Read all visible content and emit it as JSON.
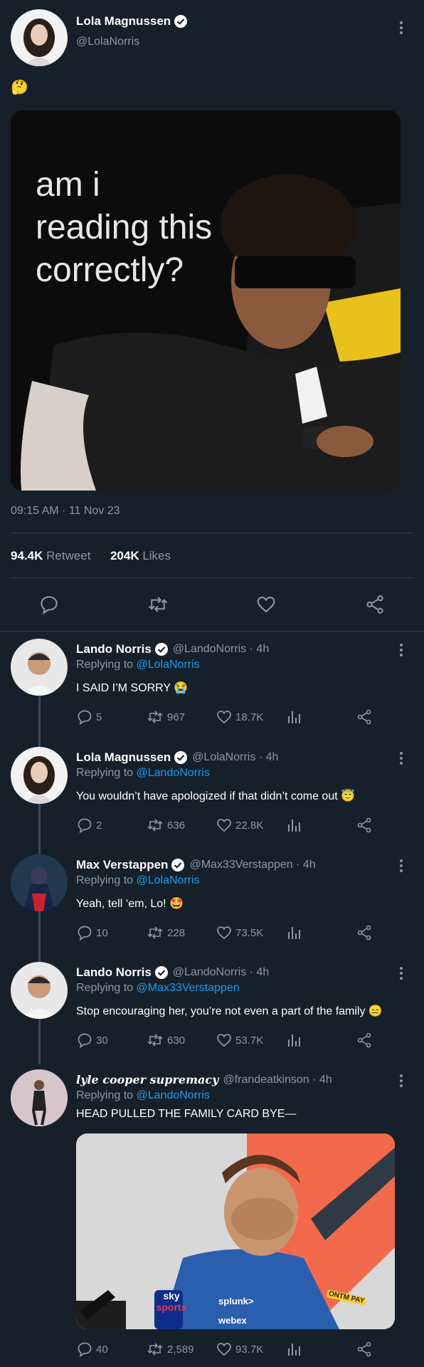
{
  "main": {
    "author": {
      "name": "Lola Magnussen",
      "handle": "@LolaNorris"
    },
    "text": "🤔",
    "image_caption": "am i reading this correctly?",
    "timestamp": "09:15 AM · 11 Nov 23",
    "stats": {
      "retweets": "94.4K",
      "retweets_label": "Retweet",
      "likes": "204K",
      "likes_label": "Likes"
    }
  },
  "replies": [
    {
      "name": "Lando Norris",
      "verified": true,
      "handle": "@LandoNorris · 4h",
      "replying_prefix": "Replying to",
      "replying_to": "@LolaNorris",
      "text": "I SAID I’M SORRY 😭",
      "replies": "5",
      "retweets": "967",
      "likes": "18.7K"
    },
    {
      "name": "Lola Magnussen",
      "verified": true,
      "handle": "@LolaNorris · 4h",
      "replying_prefix": "Replying to",
      "replying_to": "@LandoNorris",
      "text": "You wouldn’t have apologized if that didn’t come out 😇",
      "replies": "2",
      "retweets": "636",
      "likes": "22.8K"
    },
    {
      "name": "Max Verstappen",
      "verified": true,
      "handle": "@Max33Verstappen · 4h",
      "replying_prefix": "Replying to",
      "replying_to": "@LolaNorris",
      "text": "Yeah, tell ‘em, Lo! 🤩",
      "replies": "10",
      "retweets": "228",
      "likes": "73.5K"
    },
    {
      "name": "Lando Norris",
      "verified": true,
      "handle": "@LandoNorris · 4h",
      "replying_prefix": "Replying to",
      "replying_to": "@Max33Verstappen",
      "text": "Stop encouraging her, you’re not even a part of the family 😑",
      "replies": "30",
      "retweets": "630",
      "likes": "53.7K"
    },
    {
      "name": "lyle cooper supremacy",
      "verified": false,
      "handle": "@frandeatkinson · 4h",
      "replying_prefix": "Replying to",
      "replying_to": "@LandoNorris",
      "text": "HEAD PULLED THE FAMILY CARD BYE—",
      "replies": "40",
      "retweets": "2,589",
      "likes": "93.7K"
    }
  ],
  "media_text": {
    "sky": "sky",
    "sports": "sports",
    "splunk": "splunk>",
    "webex": "webex",
    "ontm": "ONTM PAY"
  },
  "icons": [
    "reply-icon",
    "retweet-icon",
    "like-icon",
    "share-icon",
    "stats-icon",
    "more-icon",
    "verified-icon"
  ],
  "colors": {
    "background": "#15202b",
    "text": "#ffffff",
    "muted": "#8b98a5",
    "link": "#1d9bf0",
    "divider": "#2f3b47"
  }
}
